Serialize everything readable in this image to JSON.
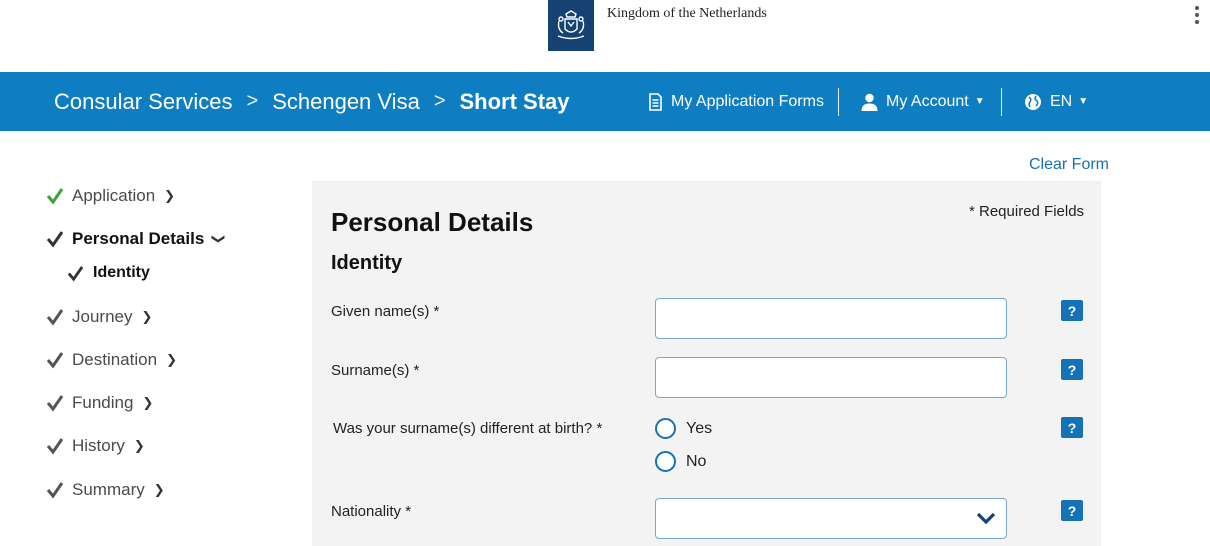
{
  "header": {
    "org_name": "Kingdom of the Netherlands",
    "logo_icon": "royal-coat-of-arms-icon",
    "menu_icon": "kebab-menu-icon"
  },
  "nav": {
    "breadcrumb": [
      "Consular Services",
      "Schengen Visa",
      "Short Stay"
    ],
    "separator": ">",
    "application_forms": "My Application Forms",
    "my_account": "My Account",
    "language": "EN",
    "bar_color": "#0f7dc2"
  },
  "sidebar": {
    "items": [
      {
        "label": "Application",
        "state": "done"
      },
      {
        "label": "Personal Details",
        "state": "active"
      },
      {
        "label": "Journey",
        "state": "pending"
      },
      {
        "label": "Destination",
        "state": "pending"
      },
      {
        "label": "Funding",
        "state": "pending"
      },
      {
        "label": "History",
        "state": "pending"
      },
      {
        "label": "Summary",
        "state": "pending"
      }
    ],
    "sub_item": "Identity",
    "done_color": "#3aa537"
  },
  "form": {
    "clear_form": "Clear Form",
    "title": "Personal Details",
    "required_note": "* Required Fields",
    "section": "Identity",
    "fields": {
      "given_names": {
        "label": "Given name(s) *",
        "value": ""
      },
      "surnames": {
        "label": "Surname(s) *",
        "value": ""
      },
      "surname_different": {
        "label": "Was your surname(s) different at birth? *",
        "options": [
          "Yes",
          "No"
        ],
        "selected": null
      },
      "nationality": {
        "label": "Nationality *",
        "value": ""
      }
    },
    "help_label": "?"
  }
}
